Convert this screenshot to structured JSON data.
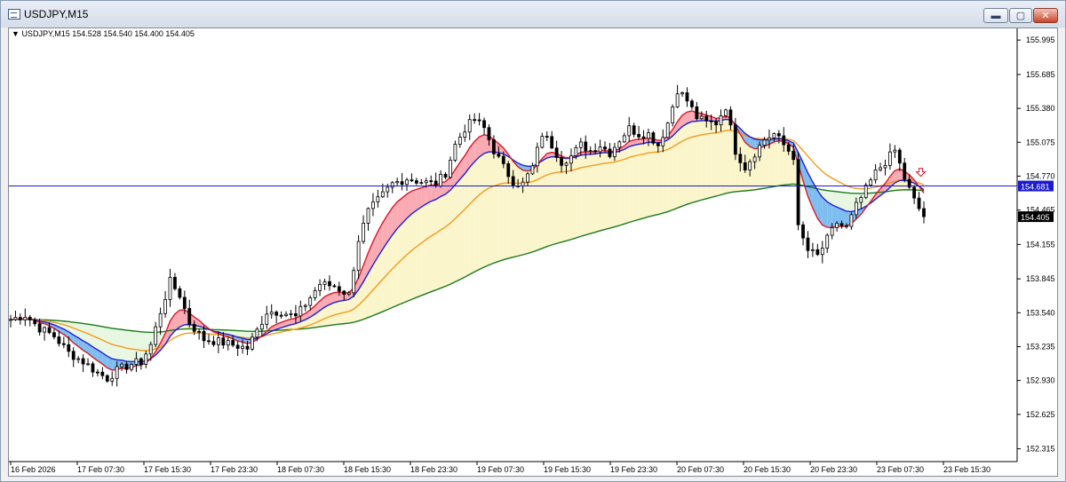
{
  "window": {
    "title": "USDJPY,M15",
    "buttons": {
      "minimize": "▬",
      "maximize": "▢",
      "close": "✕"
    }
  },
  "chart": {
    "symbol_line": "USDJPY,M15  154.528 154.540 154.400 154.405",
    "price_line_label": "154.681",
    "last_price_label": "154.405"
  },
  "colors": {
    "background": "#ffffff",
    "candle": "#000000",
    "ma_fast": "#d7192a",
    "ma_mid": "#1f1fd8",
    "ma_slow": "#f59a1b",
    "ma_long": "#1a7a1a",
    "fill_red": "#f9aab3",
    "fill_blue": "#7fbdf0",
    "fill_yellow": "#fbf5cc",
    "fill_green": "#e7f7e2",
    "price_line": "#1a1ad0"
  },
  "chart_data": {
    "type": "candlestick",
    "y_ticks": [
      "155.995",
      "155.685",
      "155.380",
      "155.075",
      "154.770",
      "154.465",
      "154.155",
      "153.845",
      "153.540",
      "153.235",
      "152.930",
      "152.625",
      "152.315"
    ],
    "x_ticks": [
      "16 Feb 2026",
      "17 Feb 07:30",
      "17 Feb 15:30",
      "17 Feb 23:30",
      "18 Feb 07:30",
      "18 Feb 15:30",
      "18 Feb 23:30",
      "19 Feb 07:30",
      "19 Feb 15:30",
      "19 Feb 23:30",
      "20 Feb 07:30",
      "20 Feb 15:30",
      "20 Feb 23:30",
      "23 Feb 07:30",
      "23 Feb 15:30"
    ],
    "ylim": [
      152.2,
      156.1
    ],
    "horizontal_line": 154.681,
    "last_close": 154.405,
    "price_keyframes": [
      [
        0,
        153.48
      ],
      [
        3,
        153.52
      ],
      [
        6,
        153.4
      ],
      [
        9,
        153.33
      ],
      [
        12,
        153.18
      ],
      [
        15,
        153.1
      ],
      [
        18,
        153.0
      ],
      [
        20,
        152.95
      ],
      [
        22,
        153.02
      ],
      [
        25,
        153.08
      ],
      [
        27,
        153.1
      ],
      [
        29,
        153.25
      ],
      [
        31,
        153.55
      ],
      [
        33,
        153.82
      ],
      [
        35,
        153.7
      ],
      [
        37,
        153.45
      ],
      [
        40,
        153.3
      ],
      [
        43,
        153.28
      ],
      [
        46,
        153.25
      ],
      [
        49,
        153.22
      ],
      [
        51,
        153.38
      ],
      [
        53,
        153.55
      ],
      [
        56,
        153.55
      ],
      [
        59,
        153.5
      ],
      [
        61,
        153.62
      ],
      [
        64,
        153.8
      ],
      [
        67,
        153.78
      ],
      [
        70,
        153.7
      ],
      [
        72,
        154.2
      ],
      [
        74,
        154.45
      ],
      [
        76,
        154.55
      ],
      [
        79,
        154.7
      ],
      [
        82,
        154.75
      ],
      [
        85,
        154.72
      ],
      [
        88,
        154.7
      ],
      [
        90,
        154.8
      ],
      [
        92,
        155.05
      ],
      [
        94,
        155.2
      ],
      [
        96,
        155.28
      ],
      [
        98,
        155.2
      ],
      [
        100,
        155.0
      ],
      [
        102,
        154.85
      ],
      [
        104,
        154.72
      ],
      [
        106,
        154.7
      ],
      [
        108,
        154.85
      ],
      [
        110,
        155.15
      ],
      [
        112,
        155.05
      ],
      [
        114,
        154.9
      ],
      [
        116,
        154.95
      ],
      [
        118,
        155.05
      ],
      [
        120,
        155.0
      ],
      [
        122,
        155.05
      ],
      [
        124,
        154.98
      ],
      [
        126,
        155.1
      ],
      [
        128,
        155.2
      ],
      [
        130,
        155.15
      ],
      [
        132,
        155.15
      ],
      [
        134,
        155.05
      ],
      [
        136,
        155.25
      ],
      [
        138,
        155.55
      ],
      [
        140,
        155.45
      ],
      [
        142,
        155.3
      ],
      [
        144,
        155.25
      ],
      [
        146,
        155.25
      ],
      [
        148,
        155.4
      ],
      [
        150,
        155.0
      ],
      [
        152,
        154.85
      ],
      [
        154,
        154.98
      ],
      [
        156,
        155.1
      ],
      [
        158,
        155.15
      ],
      [
        160,
        155.05
      ],
      [
        162,
        154.95
      ],
      [
        163,
        154.3
      ],
      [
        165,
        154.1
      ],
      [
        167,
        154.05
      ],
      [
        169,
        154.2
      ],
      [
        171,
        154.35
      ],
      [
        173,
        154.3
      ],
      [
        175,
        154.5
      ],
      [
        177,
        154.65
      ],
      [
        179,
        154.8
      ],
      [
        181,
        154.9
      ],
      [
        183,
        155.0
      ],
      [
        185,
        154.75
      ],
      [
        187,
        154.55
      ],
      [
        189,
        154.405
      ]
    ]
  }
}
